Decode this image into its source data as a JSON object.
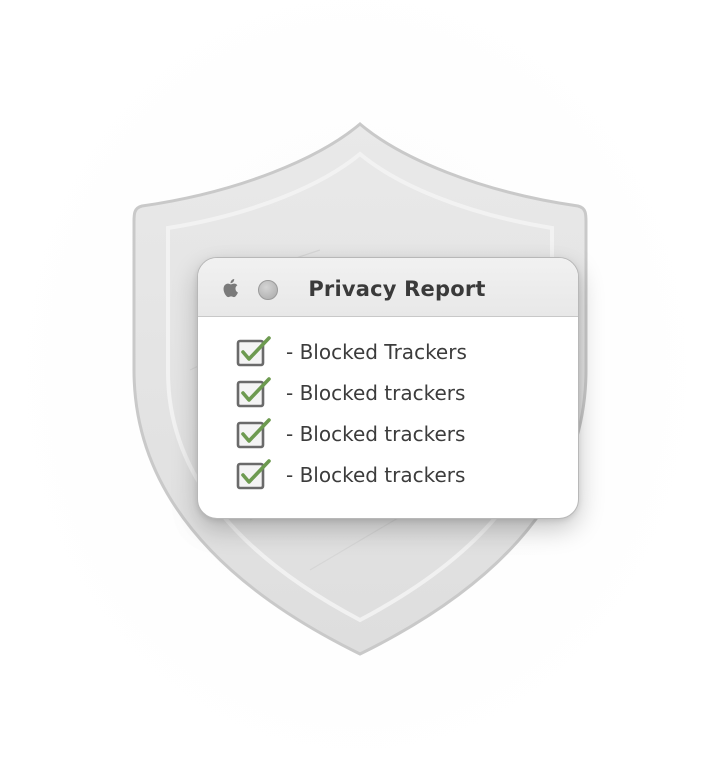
{
  "window": {
    "title": "Privacy Report",
    "buttons": [
      "apple-icon",
      "circle-button"
    ]
  },
  "report": {
    "items": [
      {
        "label": "- Blocked Trackers",
        "checked": true
      },
      {
        "label": "- Blocked trackers",
        "checked": true
      },
      {
        "label": "- Blocked trackers",
        "checked": true
      },
      {
        "label": "- Blocked trackers",
        "checked": true
      }
    ]
  },
  "colors": {
    "check": "#6d9a50",
    "shield": "#e2e2e2",
    "titlebar": "#ececec"
  }
}
